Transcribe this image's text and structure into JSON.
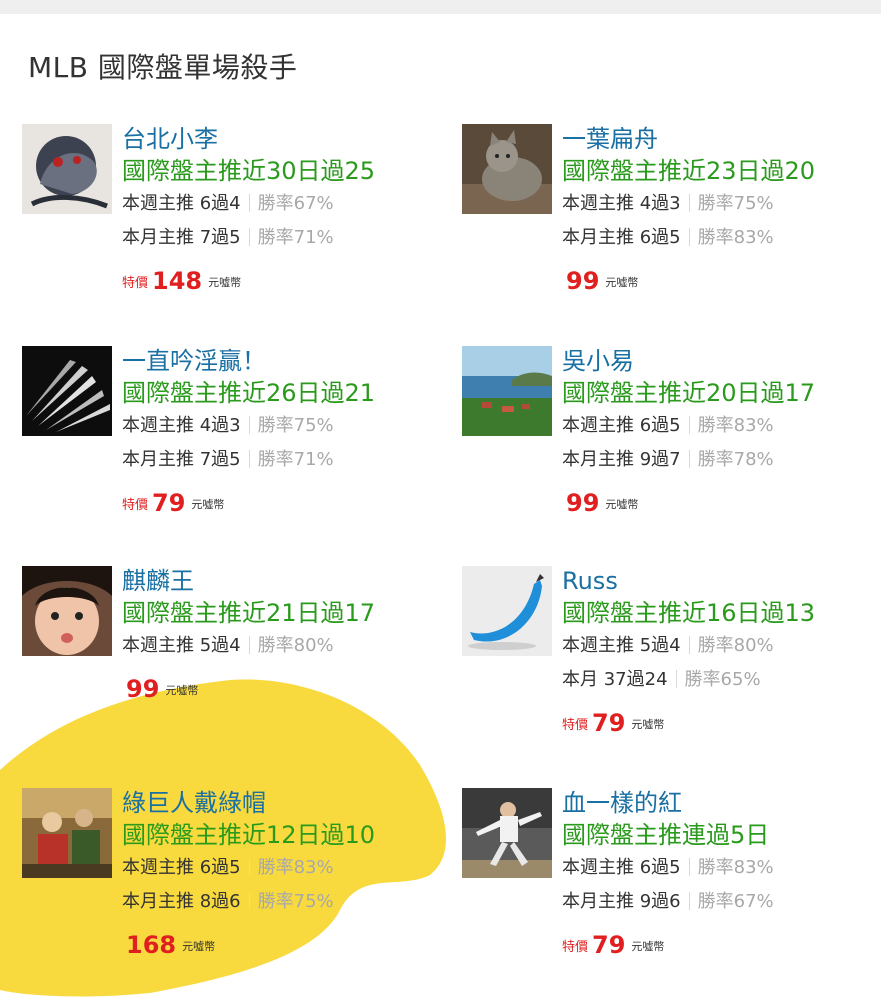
{
  "page": {
    "title": "MLB 國際盤單場殺手"
  },
  "cards": [
    {
      "name": "台北小李",
      "headline": "國際盤主推近30日過25",
      "week_label": "本週主推",
      "week_record": "6過4",
      "week_rate": "勝率67%",
      "month_label": "本月主推",
      "month_record": "7過5",
      "month_rate": "勝率71%",
      "promo": "特價",
      "price": "148",
      "currency": "元噓幣",
      "avatar_icon": "dragon-art-avatar"
    },
    {
      "name": "一葉扁舟",
      "headline": "國際盤主推近23日過20",
      "week_label": "本週主推",
      "week_record": "4過3",
      "week_rate": "勝率75%",
      "month_label": "本月主推",
      "month_record": "6過5",
      "month_rate": "勝率83%",
      "promo": "",
      "price": "99",
      "currency": "元噓幣",
      "avatar_icon": "kitten-avatar"
    },
    {
      "name": "一直吟淫贏！",
      "headline": "國際盤主推近26日過21",
      "week_label": "本週主推",
      "week_record": "4過3",
      "week_rate": "勝率75%",
      "month_label": "本月主推",
      "month_record": "7過5",
      "month_rate": "勝率71%",
      "promo": "特價",
      "price": "79",
      "currency": "元噓幣",
      "avatar_icon": "fanned-cards-avatar"
    },
    {
      "name": "吳小易",
      "headline": "國際盤主推近20日過17",
      "week_label": "本週主推",
      "week_record": "6過5",
      "week_rate": "勝率83%",
      "month_label": "本月主推",
      "month_record": "9過7",
      "month_rate": "勝率78%",
      "promo": "",
      "price": "99",
      "currency": "元噓幣",
      "avatar_icon": "coastal-landscape-avatar"
    },
    {
      "name": "麒麟王",
      "headline": "國際盤主推近21日過17",
      "week_label": "本週主推",
      "week_record": "5過4",
      "week_rate": "勝率80%",
      "month_label": "",
      "month_record": "",
      "month_rate": "",
      "promo": "",
      "price": "99",
      "currency": "元噓幣",
      "avatar_icon": "child-face-avatar"
    },
    {
      "name": "Russ",
      "headline": "國際盤主推近16日過13",
      "week_label": "本週主推",
      "week_record": "5過4",
      "week_rate": "勝率80%",
      "month_label": "本月",
      "month_record": "37過24",
      "month_rate": "勝率65%",
      "promo": "特價",
      "price": "79",
      "currency": "元噓幣",
      "avatar_icon": "blue-banana-avatar"
    },
    {
      "name": "綠巨人戴綠帽",
      "headline": "國際盤主推近12日過10",
      "week_label": "本週主推",
      "week_record": "6過5",
      "week_rate": "勝率83%",
      "month_label": "本月主推",
      "month_record": "8過6",
      "month_rate": "勝率75%",
      "promo": "",
      "price": "168",
      "currency": "元噓幣",
      "avatar_icon": "crowd-photo-avatar"
    },
    {
      "name": "血一樣的紅",
      "headline": "國際盤主推連過5日",
      "week_label": "本週主推",
      "week_record": "6過5",
      "week_rate": "勝率83%",
      "month_label": "本月主推",
      "month_record": "9過6",
      "month_rate": "勝率67%",
      "promo": "特價",
      "price": "79",
      "currency": "元噓幣",
      "avatar_icon": "baseball-pitcher-avatar"
    }
  ],
  "colors": {
    "name": "#1a6fa3",
    "headline": "#2a9a1c",
    "price": "#e02020",
    "highlight": "#f7d31c"
  }
}
